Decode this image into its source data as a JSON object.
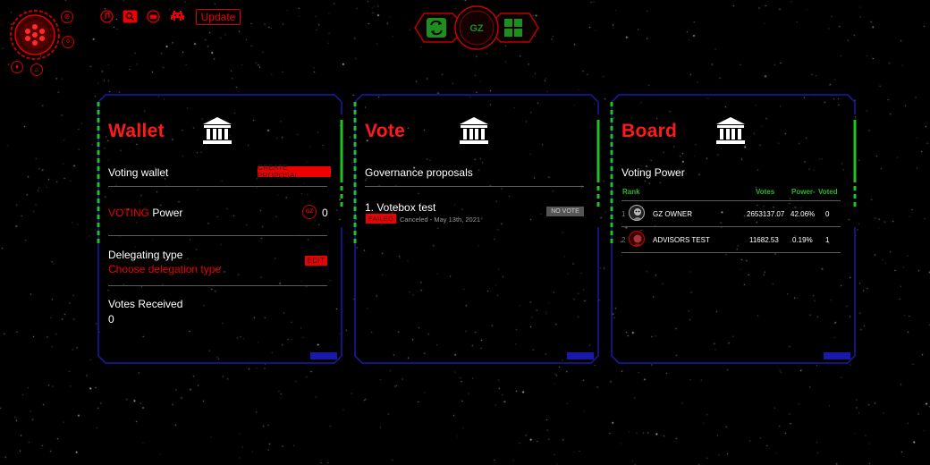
{
  "toolbar": {
    "update_label": "Update",
    "dial_badge_1": "0",
    "dial_badge_2": "0"
  },
  "hud": {
    "logo": "GZ"
  },
  "wallet": {
    "title": "Wallet",
    "voting_wallet_label": "Voting wallet",
    "create_proposal_label": "CREATE PROPOSAL",
    "voting_power_red": "VOTING",
    "voting_power_white": " Power",
    "voting_power_badge": "GZ",
    "voting_power_value": "0",
    "delegating_type_label": "Delegating type",
    "delegating_choose": "Choose delegation type",
    "edit_label": "EDIT",
    "votes_received_label": "Votes Received",
    "votes_received_value": "0"
  },
  "vote": {
    "title": "Vote",
    "subtitle": "Governance proposals",
    "proposals": [
      {
        "title": "1. Votebox test",
        "status": "FAILED",
        "meta": "Canceled - May 13th, 2021",
        "vote_badge": "NO VOTE"
      }
    ]
  },
  "board": {
    "title": "Board",
    "subtitle": "Voting Power",
    "columns": {
      "rank": "Rank",
      "votes": "Votes",
      "power": "Power",
      "voted": "Voted"
    },
    "rows": [
      {
        "rank": "1",
        "name": "GZ OWNER",
        "votes": "2653137.07",
        "power": "42.06%",
        "voted": "0"
      },
      {
        "rank": "2",
        "name": "ADVISORS TEST",
        "votes": "11682.53",
        "power": "0.19%",
        "voted": "1"
      }
    ]
  },
  "colors": {
    "accent_red": "#ff1a1a",
    "frame_blue": "#1a1aa8",
    "accent_green": "#22c022"
  }
}
